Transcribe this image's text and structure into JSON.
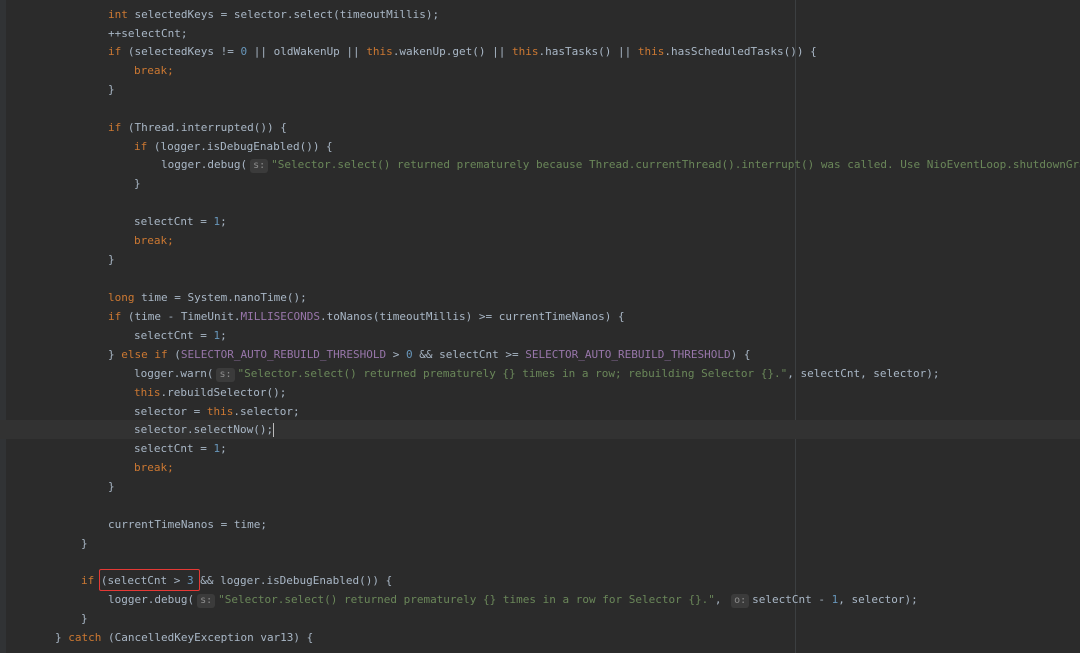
{
  "editor": {
    "lines": [
      "int selectedKeys = selector.select(timeoutMillis);",
      "++selectCnt;",
      "if (selectedKeys != 0 || oldWakenUp || this.wakenUp.get() || this.hasTasks() || this.hasScheduledTasks()) {",
      "break;",
      "}",
      "if (Thread.interrupted()) {",
      "if (logger.isDebugEnabled()) {",
      "\"Selector.select() returned prematurely because Thread.currentThread().interrupt() was called. Use NioEventLoop.shutdownGra",
      "}",
      "selectCnt = 1;",
      "break;",
      "}",
      "long time = System.nanoTime();",
      "if (time - TimeUnit.MILLISECONDS.toNanos(timeoutMillis) >= currentTimeNanos) {",
      "selectCnt = 1;",
      "} else if (SELECTOR_AUTO_REBUILD_THRESHOLD > 0 && selectCnt >= SELECTOR_AUTO_REBUILD_THRESHOLD) {",
      "\"Selector.select() returned prematurely {} times in a row; rebuilding Selector {}.\", selectCnt, selector);",
      "this.rebuildSelector();",
      "selector = this.selector;",
      "selector.selectNow();",
      "selectCnt = 1;",
      "break;",
      "}",
      "currentTimeNanos = time;",
      "}",
      "if (selectCnt > 3 && logger.isDebugEnabled()) {",
      "\"Selector.select() returned prematurely {} times in a row for Selector {}.\",",
      "}",
      "} catch (CancelledKeyException var13) {"
    ],
    "hints": {
      "s": "s:",
      "o": "o:"
    },
    "colors": {
      "background": "#2b2b2b",
      "keyword": "#cc7832",
      "number": "#6897bb",
      "string": "#6a8759",
      "field": "#9876aa",
      "text": "#a9b7c6",
      "highlight_box": "#e53935"
    }
  }
}
